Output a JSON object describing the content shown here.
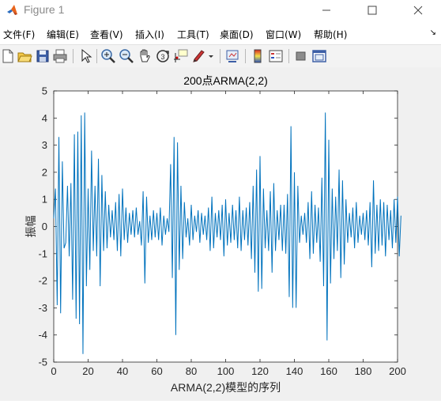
{
  "window": {
    "title": "Figure 1",
    "minimize_icon": "minimize-icon",
    "maximize_icon": "maximize-icon",
    "close_icon": "close-icon"
  },
  "menu": [
    {
      "label": "文件(F)"
    },
    {
      "label": "编辑(E)"
    },
    {
      "label": "查看(V)"
    },
    {
      "label": "插入(I)"
    },
    {
      "label": "工具(T)"
    },
    {
      "label": "桌面(D)"
    },
    {
      "label": "窗口(W)"
    },
    {
      "label": "帮助(H)"
    }
  ],
  "toolbar_icons": [
    "new-figure-icon",
    "open-file-icon",
    "save-icon",
    "print-icon",
    "pointer-icon",
    "zoom-in-icon",
    "zoom-out-icon",
    "pan-hand-icon",
    "rotate-3d-icon",
    "data-cursor-icon",
    "brush-icon",
    "brush-dropdown-icon",
    "link-plot-icon",
    "colorbar-icon",
    "legend-icon",
    "hide-plot-tools-icon",
    "show-plot-tools-icon"
  ],
  "chart_data": {
    "type": "line",
    "title": "200点ARMA(2,2)",
    "xlabel": "ARMA(2,2)模型的序列",
    "ylabel": "振幅",
    "xlim": [
      0,
      200
    ],
    "ylim": [
      -5,
      5
    ],
    "xticks": [
      0,
      20,
      40,
      60,
      80,
      100,
      120,
      140,
      160,
      180,
      200
    ],
    "yticks": [
      5,
      4,
      3,
      2,
      1,
      0,
      -1,
      -2,
      -3,
      -4,
      -5
    ],
    "grid": false,
    "series": [
      {
        "color": "#0072bd",
        "y": [
          0.3,
          1.4,
          -2.9,
          3.3,
          -3.2,
          2.4,
          -0.8,
          -0.6,
          1.5,
          -1.1,
          1.6,
          -2.7,
          3.4,
          -3.4,
          3.5,
          -3.6,
          4.1,
          -4.7,
          4.2,
          -2.2,
          1.4,
          -1.6,
          2.8,
          -0.9,
          1.5,
          -1.1,
          2.5,
          -2.2,
          1.9,
          -0.9,
          1.3,
          -0.8,
          0.8,
          -0.4,
          0.6,
          -0.5,
          0.9,
          -0.9,
          1.2,
          -1.1,
          1.4,
          -0.5,
          0.7,
          -0.6,
          0.5,
          -0.3,
          0.6,
          -0.4,
          0.7,
          -0.3,
          0.2,
          -0.7,
          1.3,
          -2.1,
          1.1,
          -0.6,
          0.4,
          -0.5,
          0.6,
          -0.4,
          0.5,
          -0.5,
          0.7,
          -0.7,
          0.4,
          -0.3,
          0.3,
          -0.2,
          2.3,
          -1.9,
          3.3,
          -4.0,
          3.1,
          -1.6,
          1.5,
          -1.2,
          0.9,
          -0.4,
          0.3,
          -0.7,
          0.8,
          -0.5,
          0.4,
          -0.2,
          0.6,
          -0.6,
          0.5,
          -0.3,
          0.4,
          -0.5,
          0.7,
          -0.9,
          1.1,
          -0.8,
          0.5,
          -0.4,
          0.6,
          -0.5,
          0.8,
          -1.1,
          1.0,
          -0.7,
          0.5,
          -0.6,
          0.8,
          -0.5,
          0.6,
          -0.8,
          1.1,
          -0.9,
          0.6,
          -0.5,
          0.7,
          -0.7,
          0.9,
          -1.2,
          1.5,
          -1.7,
          2.1,
          -2.4,
          2.6,
          -2.3,
          1.4,
          -0.8,
          0.6,
          -0.9,
          1.3,
          -1.7,
          1.6,
          -0.9,
          0.6,
          -0.5,
          0.8,
          -0.9,
          0.8,
          -1.0,
          1.2,
          -2.6,
          3.7,
          -3.0,
          2.0,
          -3.0,
          1.5,
          -0.6,
          0.4,
          -0.3,
          0.5,
          -0.6,
          0.9,
          -1.2,
          1.3,
          -1.0,
          0.8,
          -0.6,
          0.7,
          -1.3,
          1.8,
          -2.2,
          4.2,
          -4.2,
          3.2,
          -2.1,
          1.4,
          -1.2,
          1.1,
          -0.9,
          2.1,
          -1.9,
          1.7,
          -1.4,
          1.0,
          -0.6,
          0.5,
          -0.4,
          0.7,
          -0.8,
          0.9,
          -0.6,
          0.4,
          -0.3,
          0.5,
          -0.5,
          0.6,
          -0.7,
          0.9,
          -1.5,
          1.7,
          -1.0,
          0.8,
          -0.9,
          1.0,
          -0.7,
          0.9,
          -1.1,
          0.8,
          -0.5,
          0.6,
          -0.8,
          1.0,
          -0.6,
          1.1,
          -1.1,
          0.4
        ]
      }
    ]
  }
}
